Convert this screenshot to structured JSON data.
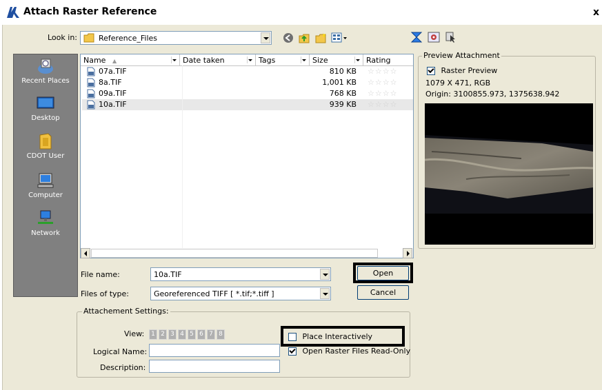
{
  "window": {
    "title": "Attach Raster Reference",
    "close_glyph": "x"
  },
  "look_in": {
    "label": "Look in:",
    "value": "Reference_Files"
  },
  "toolbar": {
    "icons": [
      "back-icon",
      "up-folder-icon",
      "new-folder-icon",
      "views-menu-icon",
      "raster-manager-icon",
      "settings-icon",
      "select-icon"
    ]
  },
  "places": [
    {
      "label": "Recent Places",
      "icon": "recent-places-icon"
    },
    {
      "label": "Desktop",
      "icon": "desktop-icon"
    },
    {
      "label": "CDOT User",
      "icon": "user-folder-icon"
    },
    {
      "label": "Computer",
      "icon": "computer-icon"
    },
    {
      "label": "Network",
      "icon": "network-icon"
    }
  ],
  "columns": [
    "Name",
    "Date taken",
    "Tags",
    "Size",
    "Rating"
  ],
  "files": [
    {
      "name": "07a.TIF",
      "size": "810 KB",
      "rating": "☆☆☆☆"
    },
    {
      "name": "8a.TIF",
      "size": "1,001 KB",
      "rating": "☆☆☆☆"
    },
    {
      "name": "09a.TIF",
      "size": "768 KB",
      "rating": "☆☆☆☆"
    },
    {
      "name": "10a.TIF",
      "size": "939 KB",
      "rating": "☆☆☆☆"
    }
  ],
  "file_name": {
    "label": "File name:",
    "value": "10a.TIF"
  },
  "file_type": {
    "label": "Files of type:",
    "value": "Georeferenced TIFF [ *.tif;*.tiff ]"
  },
  "buttons": {
    "open": "Open",
    "cancel": "Cancel"
  },
  "preview": {
    "legend": "Preview Attachment",
    "checkbox_label": "Raster Preview",
    "checked": true,
    "dims": "1079 X 471, RGB",
    "origin": "Origin: 3100855.973, 1375638.942"
  },
  "settings": {
    "legend": "Attachement Settings:",
    "view_label": "View:",
    "views": [
      "1",
      "2",
      "3",
      "4",
      "5",
      "6",
      "7",
      "8"
    ],
    "logical_name_label": "Logical Name:",
    "logical_name_value": "",
    "description_label": "Description:",
    "description_value": "",
    "place_interactively": {
      "label": "Place Interactively",
      "checked": false
    },
    "read_only": {
      "label": "Open Raster Files Read-Only",
      "checked": true
    }
  },
  "colors": {
    "highlight_box": "#000000",
    "selected_row": "#e8e8e8",
    "places_bg": "#808080"
  }
}
